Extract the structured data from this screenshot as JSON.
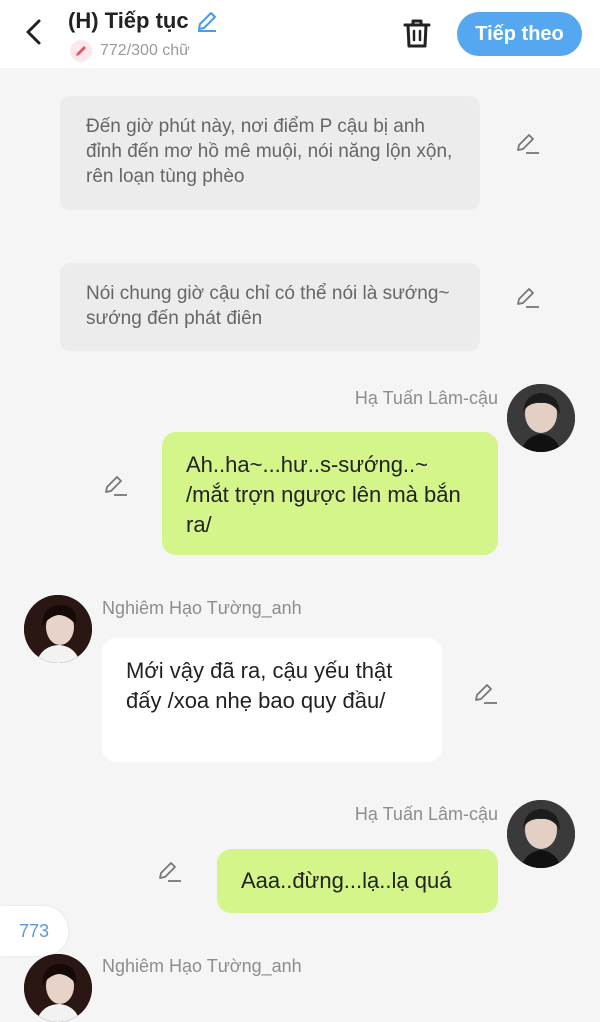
{
  "header": {
    "title": "(H) Tiếp tục",
    "word_count": "772/300 chữ",
    "next_label": "Tiếp theo"
  },
  "messages": [
    {
      "type": "note",
      "text": "Đến giờ phút này, nơi điểm P cậu bị anh đỉnh đến mơ hồ mê muội, nói năng lộn xộn, rên loạn tùng phèo"
    },
    {
      "type": "note",
      "text": "Nói chung giờ cậu chỉ có thể nói là sướng~ sướng đến phát điên"
    },
    {
      "type": "right",
      "name": "Hạ Tuấn Lâm-cậu",
      "text": "Ah..ha~...hư..s-sướng..~ /mắt trợn ngược lên mà bắn ra/"
    },
    {
      "type": "left",
      "name": "Nghiêm Hạo Tường_anh",
      "text": "Mới vậy đã ra, cậu yếu thật đấy /xoa nhẹ bao quy đầu/"
    },
    {
      "type": "right",
      "name": "Hạ Tuấn Lâm-cậu",
      "text": "Aaa..đừng...lạ..lạ quá"
    },
    {
      "type": "left",
      "name": "Nghiêm Hạo Tường_anh",
      "text": ""
    }
  ],
  "floating_counter": "773",
  "colors": {
    "accent": "#55a8f0",
    "green_bubble": "#d3f58a",
    "note_bg": "#ececec"
  }
}
